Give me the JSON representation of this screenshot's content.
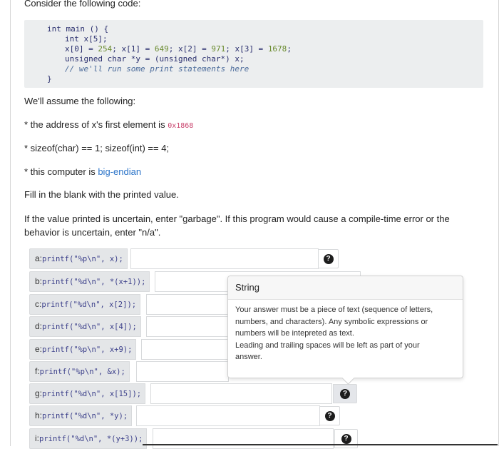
{
  "intro": "Consider the following code:",
  "code": {
    "l1": "int main () {",
    "l2": "int x[5];",
    "l3a": "x[0] = ",
    "l3b": "254",
    "l3c": "; x[1] = ",
    "l3d": "649",
    "l3e": "; x[2] = ",
    "l3f": "971",
    "l3g": "; x[3] = ",
    "l3h": "1678",
    "l3i": ";",
    "l4": "unsigned char *y = (unsigned char*) x;",
    "l5": "// we'll run some print statements here",
    "l6": "}"
  },
  "assume": "We'll assume the following:",
  "fact1_pre": "* the address of x's first element is ",
  "fact1_addr": "0x1868",
  "fact2": "* sizeof(char) == 1; sizeof(int) == 4;",
  "fact3_pre": "* this computer is ",
  "fact3_link": "big-endian",
  "fill": "Fill in the blank with the printed value.",
  "instructions": "If the value printed is uncertain, enter \"garbage\". If this program would cause a compile-time error or the behavior is uncertain, enter \"n/a\".",
  "questions": [
    {
      "letter": "a:",
      "code": "printf(\"%p\\n\", x);"
    },
    {
      "letter": "b:",
      "code": "printf(\"%d\\n\", *(x+1));"
    },
    {
      "letter": "c:",
      "code": "printf(\"%d\\n\", x[2]);"
    },
    {
      "letter": "d:",
      "code": "printf(\"%d\\n\", x[4]);"
    },
    {
      "letter": "e:",
      "code": "printf(\"%p\\n\", x+9);"
    },
    {
      "letter": "f:",
      "code": "printf(\"%p\\n\", &x);"
    },
    {
      "letter": "g:",
      "code": "printf(\"%d\\n\", x[15]);"
    },
    {
      "letter": "h:",
      "code": "printf(\"%d\\n\", *y);"
    },
    {
      "letter": "i:",
      "code": "printf(\"%d\\n\", *(y+3));"
    }
  ],
  "help_icon": "question-circle-icon",
  "help_glyph": "?",
  "popover": {
    "title": "String",
    "line1": "Your answer must be a piece of text (sequence of letters,",
    "line2": "numbers, and characters). Any symbolic expressions or",
    "line3": "numbers will be intepreted as text.",
    "line4": "Leading and trailing spaces will be left as part of your",
    "line5": "answer."
  }
}
